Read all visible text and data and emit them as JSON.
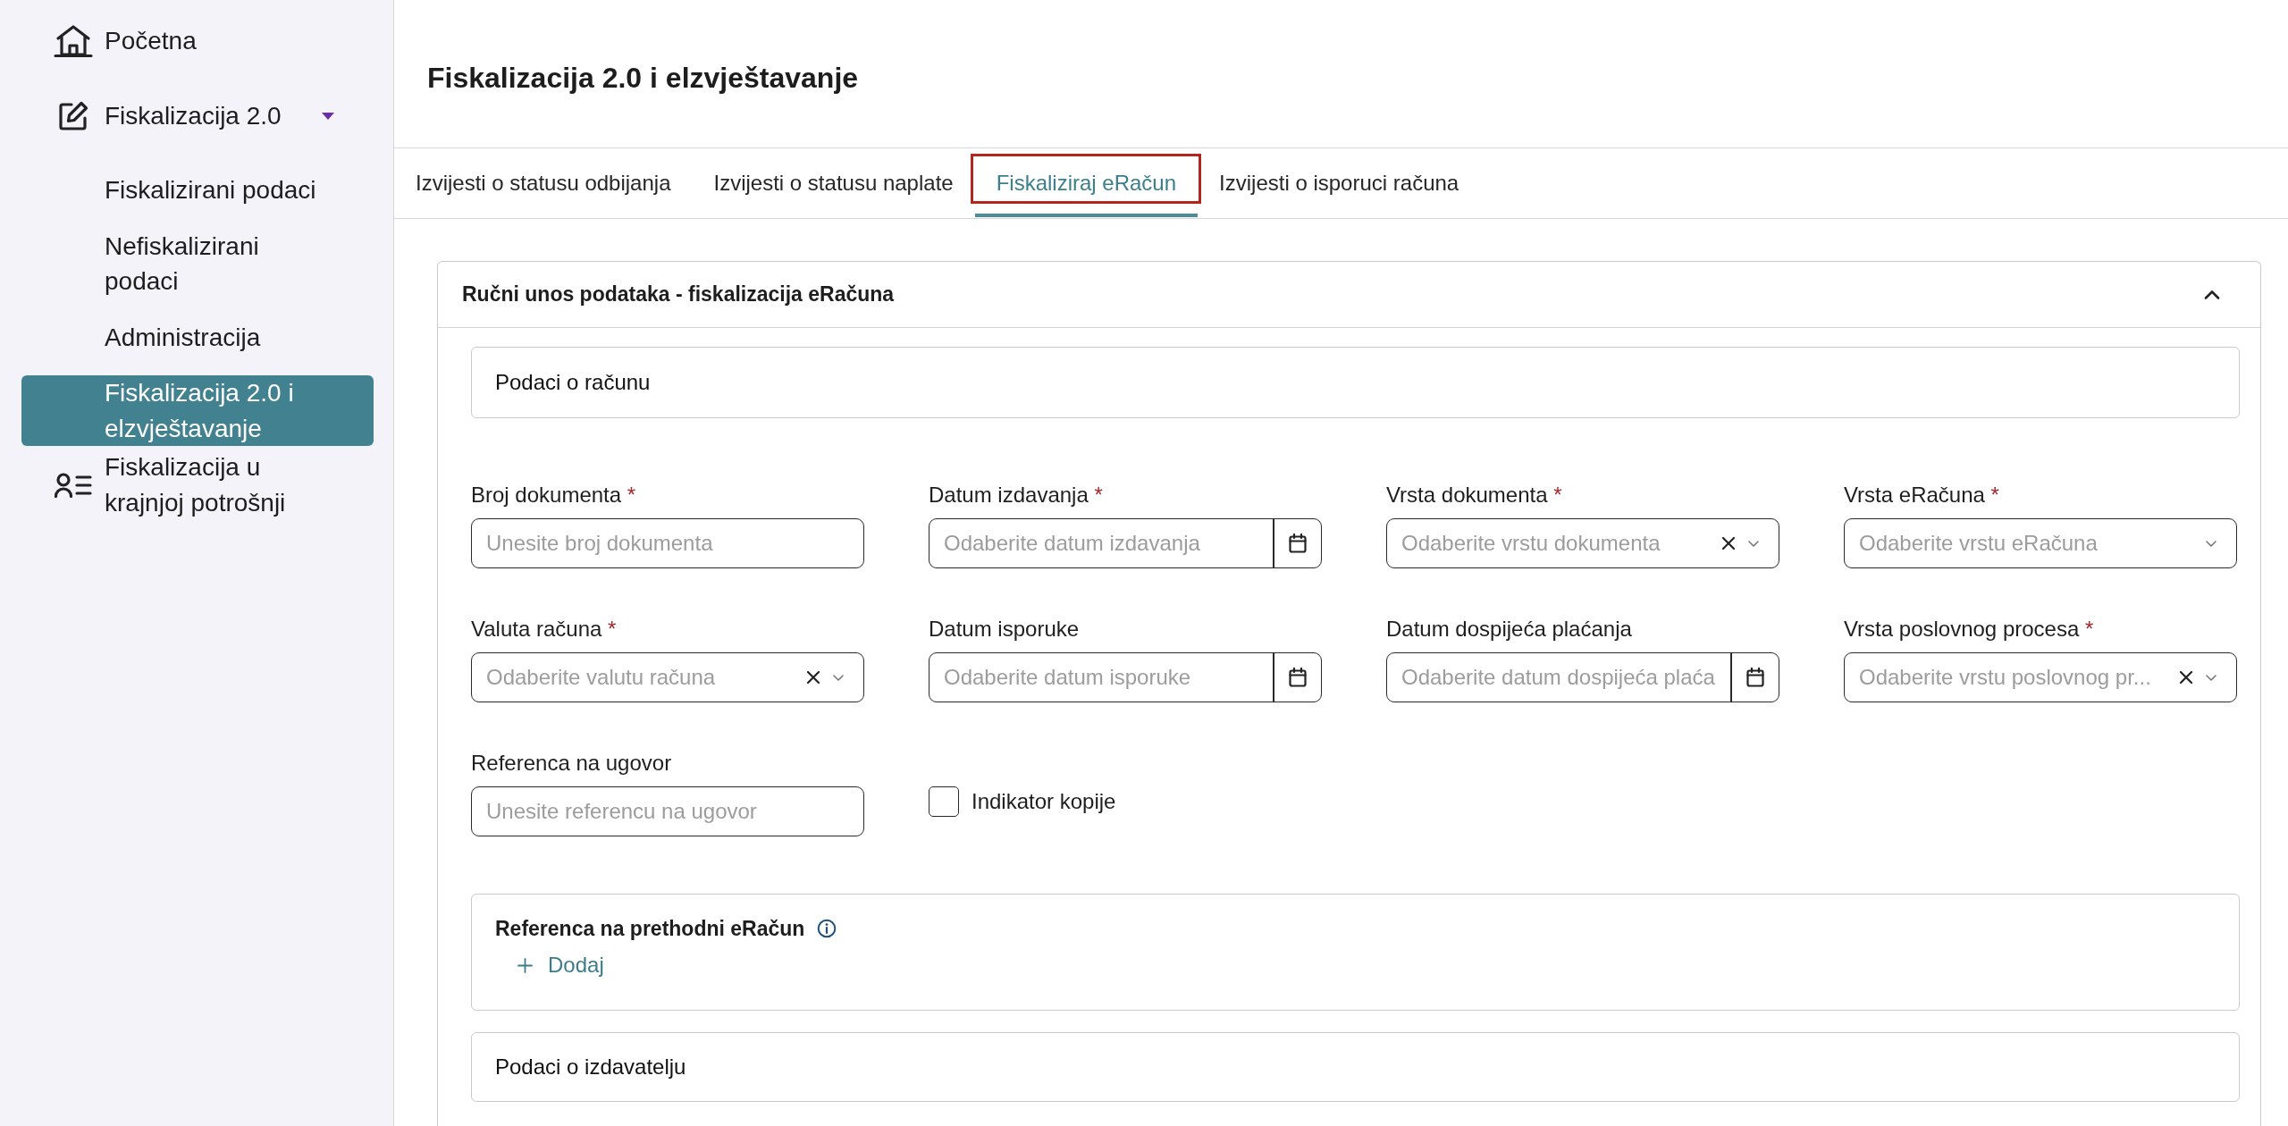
{
  "sidebar": {
    "home": {
      "label": "Početna",
      "selected": false
    },
    "fiscalization": {
      "label": "Fiskalizacija 2.0",
      "expanded": true,
      "selected": false,
      "children": [
        {
          "label": "Fiskalizirani podaci",
          "selected": false
        },
        {
          "label": "Nefiskalizirani podaci",
          "selected": false
        },
        {
          "label": "Administracija",
          "selected": false
        },
        {
          "label": "Fiskalizacija 2.0 i elzvještavanje",
          "selected": true
        }
      ]
    },
    "retail": {
      "label": "Fiskalizacija u krajnjoj potrošnji",
      "selected": false
    }
  },
  "page_title": "Fiskalizacija 2.0 i elzvještavanje",
  "tabs": [
    {
      "label": "Izvijesti o statusu odbijanja",
      "selected": false,
      "highlighted": false
    },
    {
      "label": "Izvijesti o statusu naplate",
      "selected": false,
      "highlighted": false
    },
    {
      "label": "Fiskaliziraj eRačun",
      "selected": true,
      "highlighted": true
    },
    {
      "label": "Izvijesti o isporuci računa",
      "selected": false,
      "highlighted": false
    }
  ],
  "panel": {
    "title": "Ručni unos podataka - fiskalizacija eRačuna",
    "expanded": true,
    "invoice_section": {
      "title": "Podaci o računu"
    },
    "fields": [
      {
        "kind": "text",
        "label": "Broj dokumenta",
        "required_mark": "*",
        "placeholder": "Unesite broj dokumenta"
      },
      {
        "kind": "date",
        "label": "Datum izdavanja",
        "required_mark": "*",
        "placeholder": "Odaberite datum izdavanja"
      },
      {
        "kind": "select",
        "label": "Vrsta dokumenta",
        "required_mark": "*",
        "placeholder": "Odaberite vrstu dokumenta",
        "clearable": true
      },
      {
        "kind": "select",
        "label": "Vrsta eRačuna",
        "required_mark": "*",
        "placeholder": "Odaberite vrstu eRačuna",
        "clearable": false
      },
      {
        "kind": "select",
        "label": "Valuta računa",
        "required_mark": "*",
        "placeholder": "Odaberite valutu računa",
        "clearable": true
      },
      {
        "kind": "date",
        "label": "Datum isporuke",
        "placeholder": "Odaberite datum isporuke"
      },
      {
        "kind": "date",
        "label": "Datum dospijeća plaćanja",
        "placeholder": "Odaberite datum dospijeća plaća"
      },
      {
        "kind": "select",
        "label": "Vrsta poslovnog procesa",
        "required_mark": "*",
        "placeholder": "Odaberite vrstu poslovnog pr...",
        "clearable": true
      },
      {
        "kind": "text",
        "label": "Referenca na ugovor",
        "placeholder": "Unesite referencu na ugovor"
      },
      {
        "kind": "checkbox",
        "label": "Indikator kopije",
        "checked": false
      }
    ],
    "previous_reference": {
      "title": "Referenca na prethodni eRačun",
      "add_label": "Dodaj"
    },
    "issuer_section": {
      "title": "Podaci o izdavatelju"
    }
  }
}
